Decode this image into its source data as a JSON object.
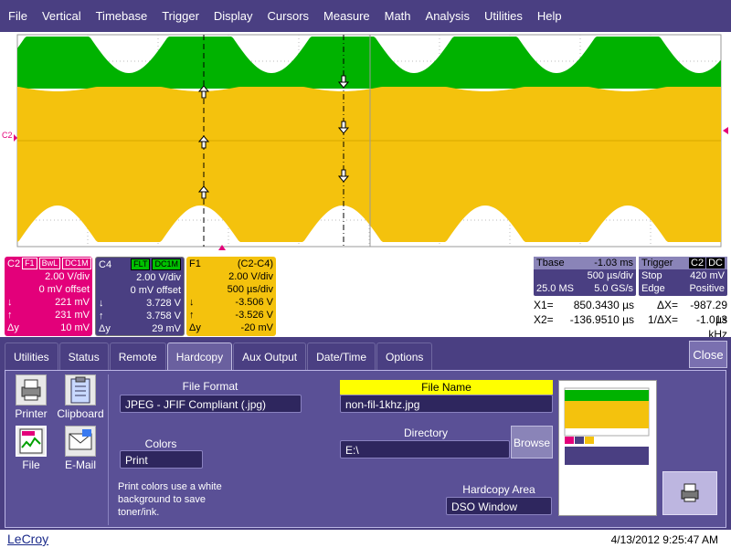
{
  "menu": [
    "File",
    "Vertical",
    "Timebase",
    "Trigger",
    "Display",
    "Cursors",
    "Measure",
    "Math",
    "Analysis",
    "Utilities",
    "Help"
  ],
  "scope": {
    "left_marker": "C2",
    "colors": {
      "green": "#00b200",
      "yellow": "#f4c20d",
      "magenta": "#e3007a",
      "panel": "#4a3f82"
    }
  },
  "channels": {
    "c2": {
      "name": "C2",
      "tags": [
        "F1",
        "BwL",
        "DC1M"
      ],
      "vdiv": "2.00 V/div",
      "offset": "0 mV offset",
      "down": "221 mV",
      "up": "231 mV",
      "dy_label": "Δy",
      "dy": "10 mV"
    },
    "c4": {
      "name": "C4",
      "tags": [
        "FLT",
        "DC1M"
      ],
      "vdiv": "2.00 V/div",
      "offset": "0 mV offset",
      "down": "3.728 V",
      "up": "3.758 V",
      "dy_label": "Δy",
      "dy": "29 mV"
    },
    "f1": {
      "name": "F1",
      "expr": "(C2-C4)",
      "vdiv": "2.00 V/div",
      "tdiv": "500 µs/div",
      "down": "-3.506 V",
      "up": "-3.526 V",
      "dy_label": "Δy",
      "dy": "-20 mV"
    }
  },
  "timebase": {
    "label": "Tbase",
    "delay": "-1.03 ms",
    "tdiv": "500 µs/div",
    "samples": "25.0 MS",
    "rate": "5.0 GS/s"
  },
  "trigger": {
    "label": "Trigger",
    "source": "C2",
    "coupling": "DC",
    "mode": "Stop",
    "level": "420 mV",
    "type": "Edge",
    "slope": "Positive"
  },
  "cursors": {
    "x1_label": "X1=",
    "x1": "850.3430 µs",
    "dx_label": "ΔX=",
    "dx": "-987.29 µs",
    "x2_label": "X2=",
    "x2": "-136.9510 µs",
    "inv_label": "1/ΔX=",
    "inv": "-1.013 kHz"
  },
  "dialog": {
    "tabs": [
      "Utilities",
      "Status",
      "Remote",
      "Hardcopy",
      "Aux Output",
      "Date/Time",
      "Options"
    ],
    "active_tab": "Hardcopy",
    "close": "Close",
    "destinations": [
      "Printer",
      "Clipboard",
      "File",
      "E-Mail"
    ],
    "file_format_label": "File Format",
    "file_format": "JPEG - JFIF Compliant (.jpg)",
    "colors_label": "Colors",
    "colors_value": "Print",
    "note": "Print colors use a white background to save toner/ink.",
    "file_name_label": "File Name",
    "file_name": "non-fil-1khz.jpg",
    "directory_label": "Directory",
    "directory": "E:\\",
    "browse": "Browse",
    "area_label": "Hardcopy Area",
    "area": "DSO Window"
  },
  "footer": {
    "brand": "LeCroy",
    "datetime": "4/13/2012 9:25:47 AM"
  }
}
